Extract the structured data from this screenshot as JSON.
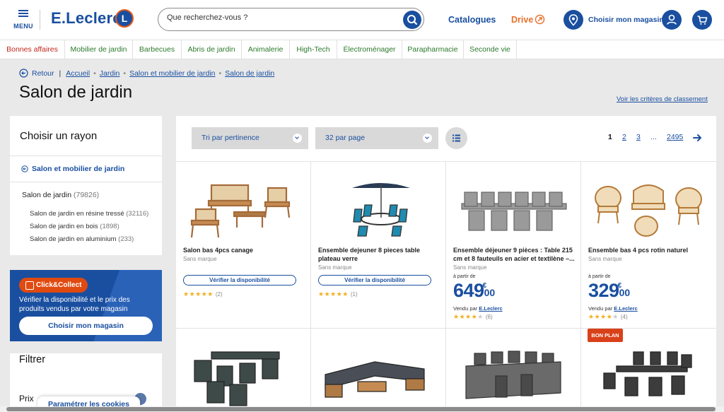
{
  "header": {
    "menu_label": "MENU",
    "logo_text": "E.Leclerc",
    "logo_badge": "L",
    "search_placeholder": "Que recherchez-vous ?",
    "catalogues": "Catalogues",
    "drive": "Drive",
    "store": "Choisir mon magasin"
  },
  "nav": [
    "Bonnes affaires",
    "Mobilier de jardin",
    "Barbecues",
    "Abris de jardin",
    "Animalerie",
    "High-Tech",
    "Électroménager",
    "Parapharmacie",
    "Seconde vie"
  ],
  "breadcrumb": {
    "back": "Retour",
    "items": [
      "Accueil",
      "Jardin",
      "Salon et mobilier de jardin",
      "Salon de jardin"
    ]
  },
  "page_title": "Salon de jardin",
  "criteria_link": "Voir les critères de classement",
  "sidebar": {
    "title": "Choisir un rayon",
    "parent": "Salon et mobilier de jardin",
    "current": {
      "label": "Salon de jardin",
      "count": "(79826)"
    },
    "children": [
      {
        "label": "Salon de jardin en résine tressé",
        "count": "(32116)"
      },
      {
        "label": "Salon de jardin en bois",
        "count": "(1898)"
      },
      {
        "label": "Salon de jardin en aluminium",
        "count": "(233)"
      }
    ]
  },
  "promo": {
    "badge": "Click&Collect",
    "text": "Vérifier la disponibilité et le prix des produits vendus par votre magasin",
    "button": "Choisir mon magasin"
  },
  "filter": {
    "title": "Filtrer",
    "price": "Prix"
  },
  "cookie": "Paramétrer les cookies",
  "toolbar": {
    "sort": "Tri par pertinence",
    "per_page": "32 par page"
  },
  "pagination": {
    "current": "1",
    "pages": [
      "2",
      "3"
    ],
    "ellipsis": "...",
    "last": "2495"
  },
  "products": [
    {
      "name": "Salon bas 4pcs canage",
      "brand": "Sans marque",
      "action": "Vérifier la disponibilité",
      "rating": 5,
      "reviews": "(2)"
    },
    {
      "name": "Ensemble dejeuner 8 pieces table plateau verre",
      "brand": "Sans marque",
      "action": "Vérifier la disponibilité",
      "rating": 5,
      "reviews": "(1)"
    },
    {
      "name": "Ensemble déjeuner 9 pièces : Table 215 cm et 8 fauteuils en acier et textilène –...",
      "brand": "Sans marque",
      "from": "à partir de",
      "price_int": "649",
      "price_cur": "€",
      "price_dec": "00",
      "seller_prefix": "Vendu par",
      "seller": "E.Leclerc",
      "rating": 4,
      "reviews": "(6)"
    },
    {
      "name": "Ensemble bas 4 pcs rotin naturel",
      "brand": "Sans marque",
      "from": "à partir de",
      "price_int": "329",
      "price_cur": "€",
      "price_dec": "00",
      "seller_prefix": "Vendu par",
      "seller": "E.Leclerc",
      "rating": 4,
      "reviews": "(4)"
    }
  ],
  "badge_bon_plan": "BON PLAN",
  "colors": {
    "brand_blue": "#1a4fa0",
    "drive_orange": "#e8702a",
    "nav_green": "#2d7a2d",
    "first_nav_red": "#c0281e",
    "star": "#f2b01e",
    "badge": "#d9411a"
  },
  "icons": [
    "menu-icon",
    "search-icon",
    "drive-icon",
    "location-pin-icon",
    "user-icon",
    "cart-icon",
    "back-arrow-icon",
    "list-view-icon",
    "next-arrow-icon"
  ]
}
